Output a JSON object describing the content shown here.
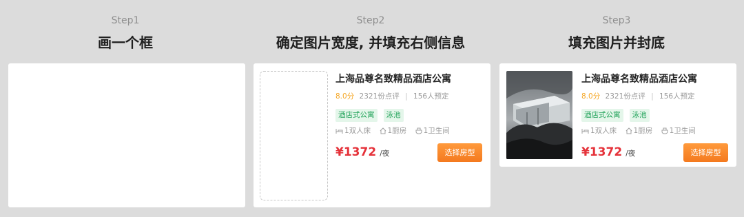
{
  "steps": [
    {
      "label": "Step1",
      "title": "画一个框"
    },
    {
      "label": "Step2",
      "title": "确定图片宽度, 并填充右侧信息"
    },
    {
      "label": "Step3",
      "title": "填充图片并封底"
    }
  ],
  "card": {
    "name": "上海品尊名致精品酒店公寓",
    "score": "8.0分",
    "reviews": "2321份点评",
    "bookings": "156人预定",
    "tags": [
      "酒店式公寓",
      "泳池"
    ],
    "facilities": [
      {
        "icon": "bed-icon",
        "label": "1双人床"
      },
      {
        "icon": "kitchen-icon",
        "label": "1厨房"
      },
      {
        "icon": "bathroom-icon",
        "label": "1卫生间"
      }
    ],
    "price": "¥1372",
    "price_unit": "/夜",
    "button": "选择房型"
  },
  "colors": {
    "score": "#f5a623",
    "tag_text": "#22a35a",
    "tag_bg": "#e4f6ea",
    "price": "#e5323a",
    "button": "#f47a1f"
  }
}
